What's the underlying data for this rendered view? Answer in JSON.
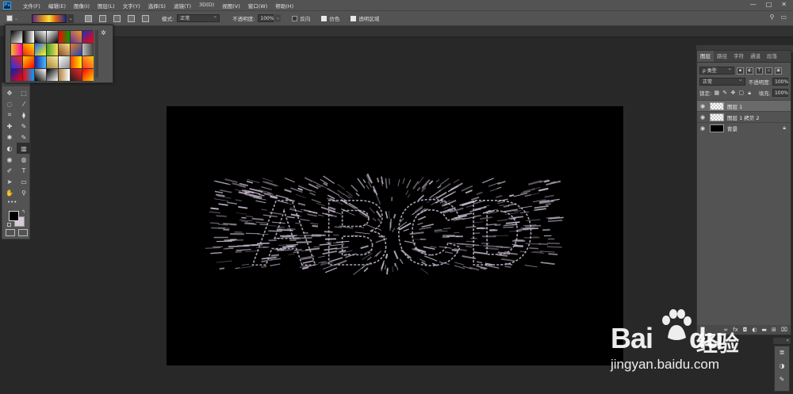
{
  "app": {
    "logo": "Ps"
  },
  "menu": [
    "文件(F)",
    "编辑(E)",
    "图像(I)",
    "图层(L)",
    "文字(Y)",
    "选择(S)",
    "滤镜(T)",
    "3D(D)",
    "视图(V)",
    "窗口(W)",
    "帮助(H)"
  ],
  "window_controls": [
    "—",
    "□",
    "✕"
  ],
  "options": {
    "mode_label": "模式:",
    "mode_value": "正常",
    "opacity_label": "不透明度:",
    "opacity_value": "100%",
    "reverse_label": "反向",
    "dither_label": "仿色",
    "transparency_label": "透明区域",
    "reverse_checked": false,
    "dither_checked": true,
    "transparency_checked": true,
    "right_icons": [
      "search-icon",
      "workspace-icon"
    ]
  },
  "gradient_presets": [
    [
      "#000000",
      "#ffffff"
    ],
    [
      "#000000",
      "#ffffff"
    ],
    [
      "#000000",
      "#ffffff"
    ],
    [
      "#ffffff",
      "#000000"
    ],
    [
      "#ff0000",
      "#00a000"
    ],
    [
      "#6a2aa0",
      "#f0a020"
    ],
    [
      "#2030c0",
      "#ff0000"
    ],
    [
      "#f0c020",
      "#ff00a0"
    ],
    [
      "#ff2000",
      "#ffe000"
    ],
    [
      "#2060ff",
      "#ffff00"
    ],
    [
      "#40a020",
      "#ffe060"
    ],
    [
      "#8a4a20",
      "#ffe090"
    ],
    [
      "#e08020",
      "#2040c0"
    ],
    [
      "#c0c0c0",
      "#404040"
    ],
    [
      "#2030ff",
      "#ff2000"
    ],
    [
      "#ffd000",
      "#ff0000"
    ],
    [
      "#2020a0",
      "#40c0ff"
    ],
    [
      "#a08030",
      "#fff0a0"
    ],
    [
      "#ffffff",
      "#8a8a8a"
    ],
    [
      "#ff4000",
      "#fff000"
    ],
    [
      "#ff3030",
      "#ffd000"
    ],
    [
      "#0020c0",
      "#ff0000"
    ],
    [
      "#ff0000",
      "#00a0ff"
    ],
    [
      "#000000",
      "#ffffff"
    ],
    [
      "#000000",
      "#ffffff"
    ],
    [
      "#b08040",
      "#ffffff"
    ],
    [
      "#202020",
      "#ff2020"
    ],
    [
      "#ff0000",
      "#ffd000"
    ]
  ],
  "toolbar": {
    "tools": [
      "✥",
      "⬚",
      "◌",
      "⁄",
      "⌗",
      "⧫",
      "✚",
      "✎",
      "✱",
      "✎",
      "◐",
      "▥",
      "◉",
      "◍",
      "✐",
      "T",
      "➤",
      "▭",
      "✋",
      "⚲"
    ],
    "more": "•••",
    "colors": {
      "foreground": "#000000",
      "background": "#d9c9d9"
    }
  },
  "layers_panel": {
    "tabs": [
      "图层",
      "路径",
      "字符",
      "通道",
      "段落"
    ],
    "active_tab": 0,
    "filter_label": "ρ 类型",
    "blend_mode": "正常",
    "opacity_label": "不透明度:",
    "opacity_value": "100%",
    "lock_label": "锁定:",
    "fill_label": "填充:",
    "fill_value": "100%",
    "layers": [
      {
        "name": "图层 1",
        "selected": true,
        "thumb": "transparent",
        "locked": false
      },
      {
        "name": "图层 1 拷贝 2",
        "selected": false,
        "thumb": "transparent",
        "locked": false
      },
      {
        "name": "背景",
        "selected": false,
        "thumb": "black",
        "locked": true
      }
    ],
    "footer_icons": [
      "link-icon",
      "fx-icon",
      "mask-icon",
      "adjustment-icon",
      "folder-icon",
      "new-layer-icon",
      "trash-icon"
    ]
  },
  "canvas": {
    "text": "ABCD",
    "background": "#000000",
    "stroke_color": "#c8bcd0"
  },
  "watermark": {
    "logo_prefix": "Bai",
    "logo_suffix": "du",
    "cn": "经验",
    "url": "jingyan.baidu.com"
  }
}
